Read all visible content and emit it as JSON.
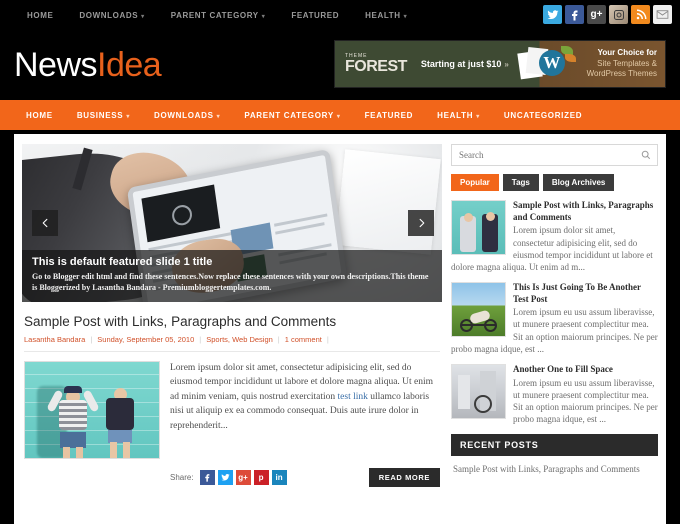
{
  "topbar": {
    "nav": [
      {
        "label": "HOME",
        "caret": false
      },
      {
        "label": "DOWNLOADS",
        "caret": true
      },
      {
        "label": "PARENT CATEGORY",
        "caret": true
      },
      {
        "label": "FEATURED",
        "caret": false
      },
      {
        "label": "HEALTH",
        "caret": true
      }
    ],
    "socials": [
      {
        "name": "twitter-icon",
        "glyph": "t"
      },
      {
        "name": "facebook-icon",
        "glyph": "f"
      },
      {
        "name": "google-plus-icon",
        "glyph": "g+"
      },
      {
        "name": "instagram-icon",
        "glyph": "◎"
      },
      {
        "name": "rss-icon",
        "glyph": "◔"
      },
      {
        "name": "email-icon",
        "glyph": "✉"
      }
    ]
  },
  "header": {
    "logo_part1": "News",
    "logo_part2": "Idea",
    "ad": {
      "brand_small": "THEME",
      "brand_large": "FOREST",
      "price": "Starting at just $10",
      "arrow": "»",
      "right_line1": "Your Choice for",
      "right_line2": "Site Templates &",
      "right_line3": "WordPress Themes",
      "wp_glyph": "W"
    }
  },
  "mainnav": {
    "items": [
      {
        "label": "HOME",
        "caret": false
      },
      {
        "label": "BUSINESS",
        "caret": true
      },
      {
        "label": "DOWNLOADS",
        "caret": true
      },
      {
        "label": "PARENT CATEGORY",
        "caret": true
      },
      {
        "label": "FEATURED",
        "caret": false
      },
      {
        "label": "HEALTH",
        "caret": true
      },
      {
        "label": "UNCATEGORIZED",
        "caret": false
      }
    ]
  },
  "slider": {
    "title": "This is default featured slide 1 title",
    "description": "Go to Blogger edit html and find these sentences.Now replace these sentences with your own descriptions.This theme is Bloggerized by Lasantha Bandara - Premiumbloggertemplates.com.",
    "prev_label": "‹",
    "next_label": "›"
  },
  "post": {
    "title": "Sample Post with Links, Paragraphs and Comments",
    "author": "Lasantha Bandara",
    "date": "Sunday, September 05, 2010",
    "categories": "Sports, Web Design",
    "comments": "1 comment",
    "separator": "|",
    "body_1": "Lorem ipsum dolor sit amet, consectetur adipisicing elit, sed do eiusmod tempor incididunt ut labore et dolore magna aliqua. Ut enim ad minim veniam, quis nostrud exercitation ",
    "body_link": "test link",
    "body_2": " ullamco laboris nisi ut aliquip ex ea commodo consequat. Duis aute irure dolor in reprehenderit...",
    "share_label": "Share:",
    "share_buttons": [
      {
        "name": "share-facebook",
        "glyph": "f"
      },
      {
        "name": "share-twitter",
        "glyph": "t"
      },
      {
        "name": "share-googleplus",
        "glyph": "g+"
      },
      {
        "name": "share-pinterest",
        "glyph": "p"
      },
      {
        "name": "share-linkedin",
        "glyph": "in"
      }
    ],
    "read_more": "READ MORE"
  },
  "sidebar": {
    "search": {
      "placeholder": "Search",
      "value": "",
      "icon": "⚲"
    },
    "tabs": [
      {
        "label": "Popular",
        "active": true
      },
      {
        "label": "Tags",
        "active": false
      },
      {
        "label": "Blog Archives",
        "active": false
      }
    ],
    "popular": [
      {
        "title": "Sample Post with Links, Paragraphs and Comments",
        "excerpt": "Lorem ipsum dolor sit amet, consectetur adipisicing elit, sed do eiusmod tempor incididunt ut labore et dolore magna aliqua. Ut enim ad m..."
      },
      {
        "title": "This Is Just Going To Be Another Test Post",
        "excerpt": "Lorem ipsum eu usu assum liberavisse, ut munere praesent complectitur mea. Sit an option maiorum principes. Ne per probo magna idque, est ..."
      },
      {
        "title": "Another One to Fill Space",
        "excerpt": "Lorem ipsum eu usu assum liberavisse, ut munere praesent complectitur mea. Sit an option maiorum principes. Ne per probo magna idque, est ..."
      }
    ],
    "recent": {
      "heading": "RECENT POSTS",
      "items": [
        "Sample Post with Links, Paragraphs and Comments"
      ]
    }
  },
  "colors": {
    "accent": "#f2661a",
    "dark": "#2b2b2b",
    "meta": "#d1512a"
  }
}
